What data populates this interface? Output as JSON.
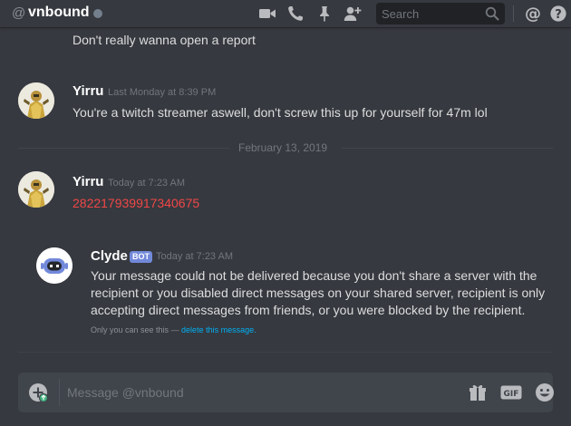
{
  "header": {
    "at_symbol": "@",
    "dm_name": "vnbound",
    "status_color": "#747f8d",
    "icons": [
      "video-call-icon",
      "voice-call-icon",
      "pinned-messages-icon",
      "add-friend-icon",
      "search-icon",
      "mention-icon",
      "help-icon"
    ],
    "search": {
      "placeholder": "Search"
    },
    "mention_label": "@",
    "help_label": "?"
  },
  "messages": {
    "continued_text": "Don't really wanna open a report",
    "group1": {
      "username": "Yirru",
      "timestamp": "Last Monday at 8:39 PM",
      "text": "You're a twitch streamer aswell, don't screw this up for yourself for 47m lol"
    },
    "date_divider": "February 13, 2019",
    "group2": {
      "username": "Yirru",
      "timestamp": "Today at 7:23 AM",
      "text": "282217939917340675",
      "text_color": "#f04747"
    },
    "clyde": {
      "username": "Clyde",
      "bot_tag": "BOT",
      "timestamp": "Today at 7:23 AM",
      "lines": [
        "Your message could not be delivered because you don't share a server with the",
        "recipient or you disabled direct messages on your shared server, recipient is only",
        "accepting direct messages from friends, or you were blocked by the recipient."
      ],
      "only_you_text": "Only you can see this — ",
      "delete_link": "delete this message."
    }
  },
  "composer": {
    "placeholder": "Message @vnbound",
    "icons": [
      "upload-icon",
      "gift-icon",
      "gif-icon",
      "emoji-icon"
    ],
    "gif_label": "GIF"
  },
  "colors": {
    "background": "#36393f",
    "accent": "#7289da",
    "link": "#00b0f4",
    "error_text": "#f04747"
  }
}
